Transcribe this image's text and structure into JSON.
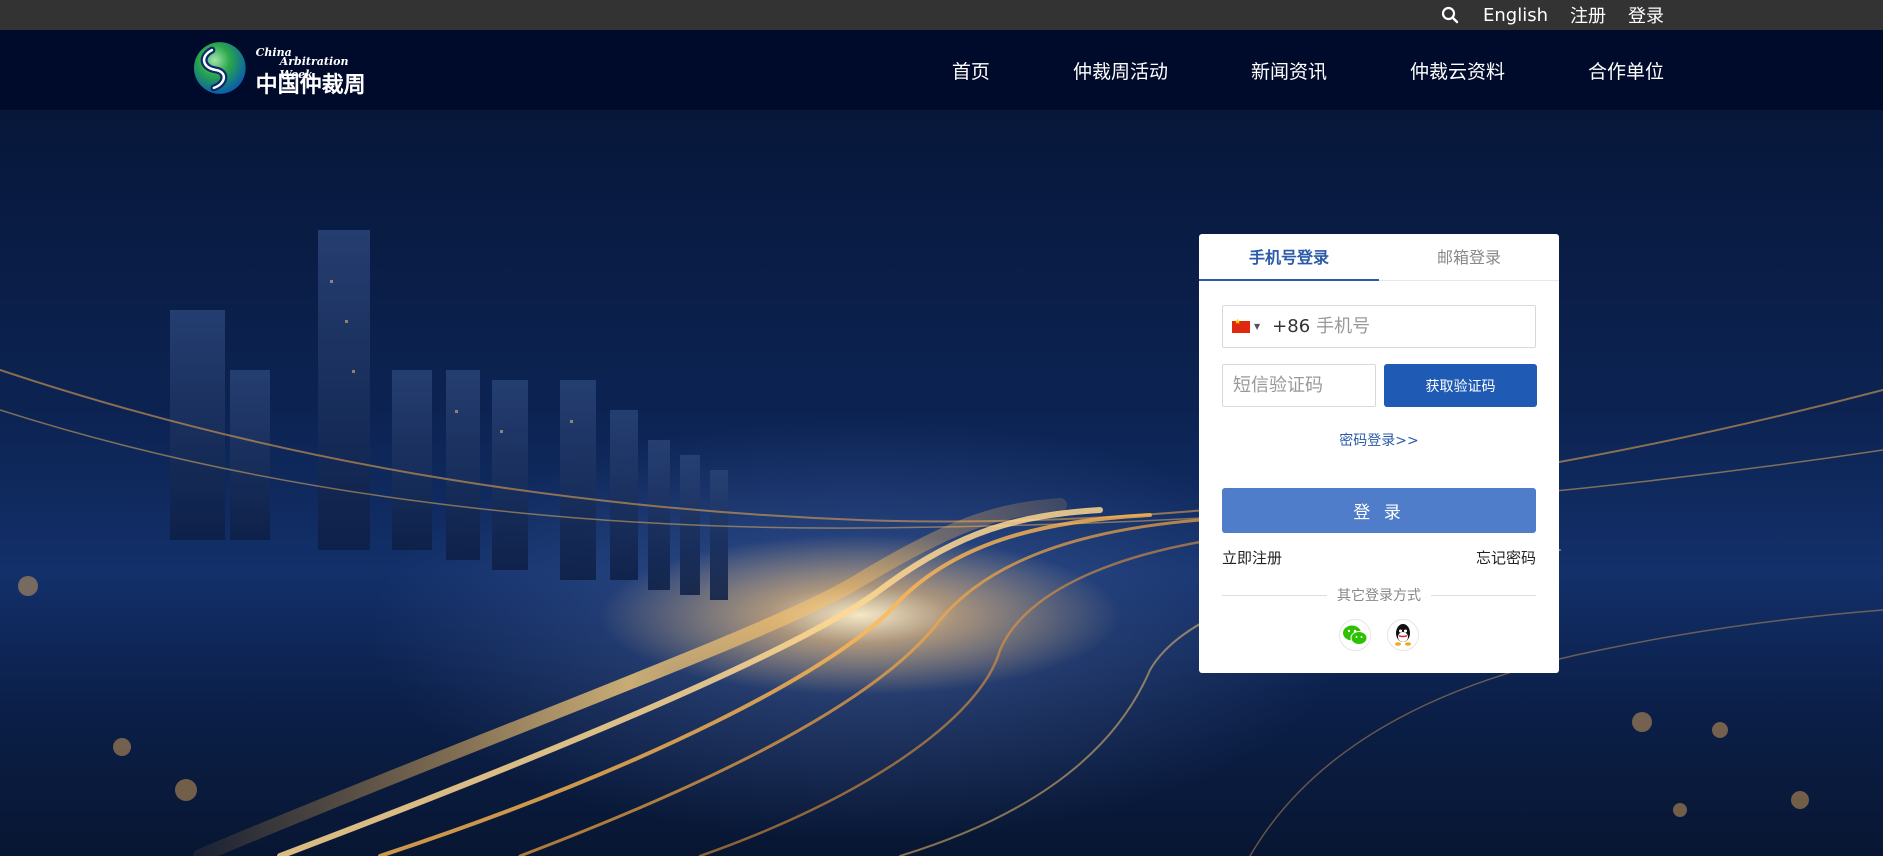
{
  "topbar": {
    "language": "English",
    "register": "注册",
    "login": "登录"
  },
  "logo": {
    "en_line1": "China",
    "en_line2": "Arbitration Week",
    "cn": "中国仲裁周"
  },
  "nav": {
    "items": [
      {
        "label": "首页"
      },
      {
        "label": "仲裁周活动"
      },
      {
        "label": "新闻资讯"
      },
      {
        "label": "仲裁云资料"
      },
      {
        "label": "合作单位"
      }
    ]
  },
  "login_card": {
    "tabs": [
      {
        "label": "手机号登录",
        "active": true
      },
      {
        "label": "邮箱登录",
        "active": false
      }
    ],
    "country_code": "+86",
    "phone_placeholder": "手机号",
    "sms_placeholder": "短信验证码",
    "get_code_label": "获取验证码",
    "password_login_link": "密码登录>>",
    "login_button": "登 录",
    "register_link": "立即注册",
    "forgot_link": "忘记密码",
    "other_methods": "其它登录方式",
    "social": [
      {
        "icon": "wechat-icon"
      },
      {
        "icon": "qq-icon"
      }
    ]
  },
  "colors": {
    "accent": "#1f5bb5",
    "login_button": "#4f7dc9",
    "topbar": "#333333",
    "navbar": "#000a2a"
  }
}
